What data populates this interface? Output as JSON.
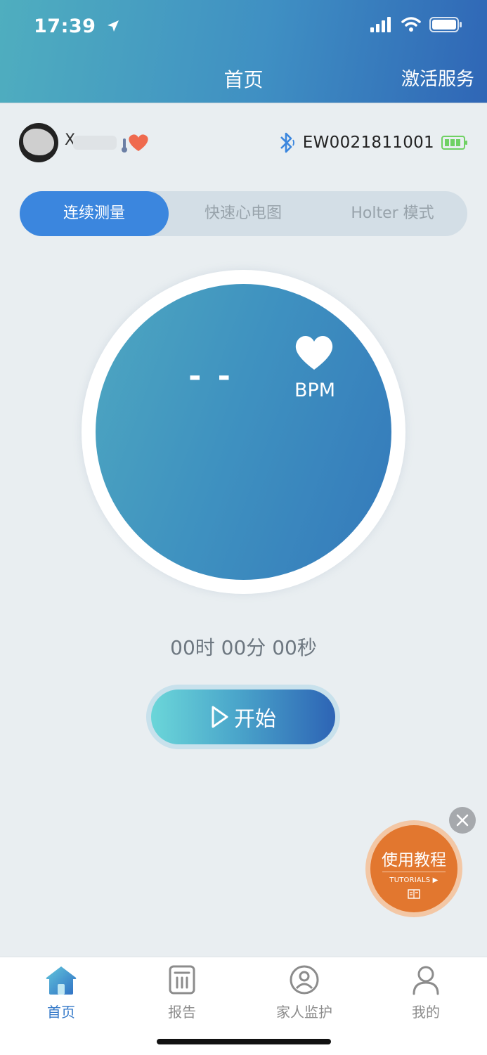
{
  "status_bar": {
    "time": "17:39"
  },
  "header": {
    "title": "首页",
    "action_label": "激活服务"
  },
  "user": {
    "name_visible": "X",
    "device_id": "EW0021811001"
  },
  "modes": [
    {
      "label": "连续测量",
      "active": true
    },
    {
      "label": "快速心电图",
      "active": false
    },
    {
      "label": "Holter 模式",
      "active": false
    }
  ],
  "measurement": {
    "bpm_value": "- -",
    "bpm_unit": "BPM",
    "timer": "00时 00分 00秒"
  },
  "start_button": {
    "label": "开始"
  },
  "tutorial": {
    "title": "使用教程",
    "subtitle": "TUTORIALS ▶"
  },
  "tabbar": [
    {
      "label": "首页",
      "icon": "home-icon",
      "active": true
    },
    {
      "label": "报告",
      "icon": "report-icon",
      "active": false
    },
    {
      "label": "家人监护",
      "icon": "family-monitor-icon",
      "active": false
    },
    {
      "label": "我的",
      "icon": "profile-icon",
      "active": false
    }
  ],
  "colors": {
    "accent": "#3b86de",
    "tutorial": "#e2772f",
    "battery": "#6fd163",
    "bluetooth": "#3b86de"
  }
}
